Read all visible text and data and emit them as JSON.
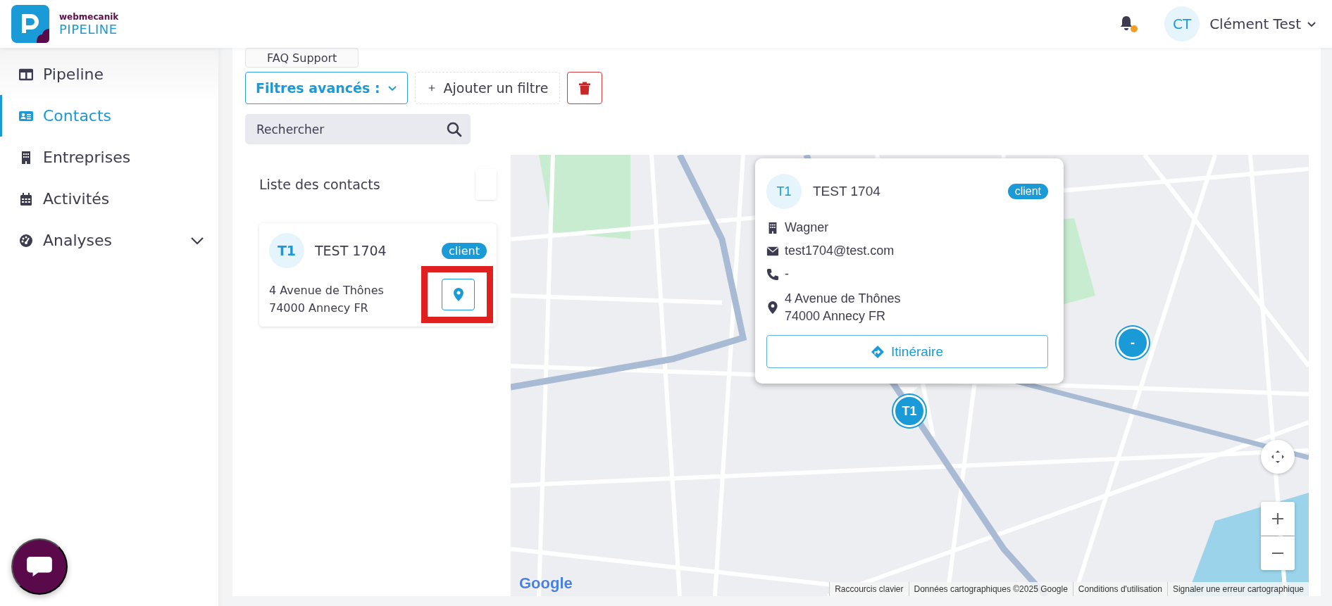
{
  "header": {
    "logo": {
      "brand": "webmecanik",
      "product": "PIPELINE"
    },
    "notifications": {
      "unread": true
    },
    "user": {
      "initials": "CT",
      "name": "Clément Test"
    }
  },
  "sidebar": {
    "items": [
      {
        "label": "Pipeline",
        "selected": false,
        "expandable": false
      },
      {
        "label": "Contacts",
        "selected": true,
        "expandable": false
      },
      {
        "label": "Entreprises",
        "selected": false,
        "expandable": false
      },
      {
        "label": "Activités",
        "selected": false,
        "expandable": false
      },
      {
        "label": "Analyses",
        "selected": false,
        "expandable": true
      }
    ]
  },
  "toolbar": {
    "faq_button": "FAQ Support",
    "filter_dropdown": "Filtres avancés :",
    "add_filter": "Ajouter un filtre"
  },
  "search": {
    "placeholder": "Rechercher"
  },
  "contact_list": {
    "title": "Liste des contacts",
    "contacts": [
      {
        "initials": "T1",
        "name": "TEST 1704",
        "tag": "client",
        "address": [
          "4 Avenue de Thônes",
          "74000 Annecy FR"
        ],
        "highlighted": true
      }
    ]
  },
  "map": {
    "popup": {
      "initials": "T1",
      "name": "TEST 1704",
      "tag": "client",
      "company": "Wagner",
      "email": "test1704@test.com",
      "phone": "-",
      "address": [
        "4 Avenue de Thônes",
        "74000 Annecy FR"
      ],
      "button": "Itinéraire"
    },
    "markers": [
      {
        "kind": "contact",
        "label": "T1"
      },
      {
        "kind": "cluster",
        "label": "-"
      }
    ],
    "logo": "Google",
    "attribution": [
      "Raccourcis clavier",
      "Données cartographiques ©2025 Google",
      "Conditions d'utilisation",
      "Signaler une erreur cartographique"
    ]
  }
}
